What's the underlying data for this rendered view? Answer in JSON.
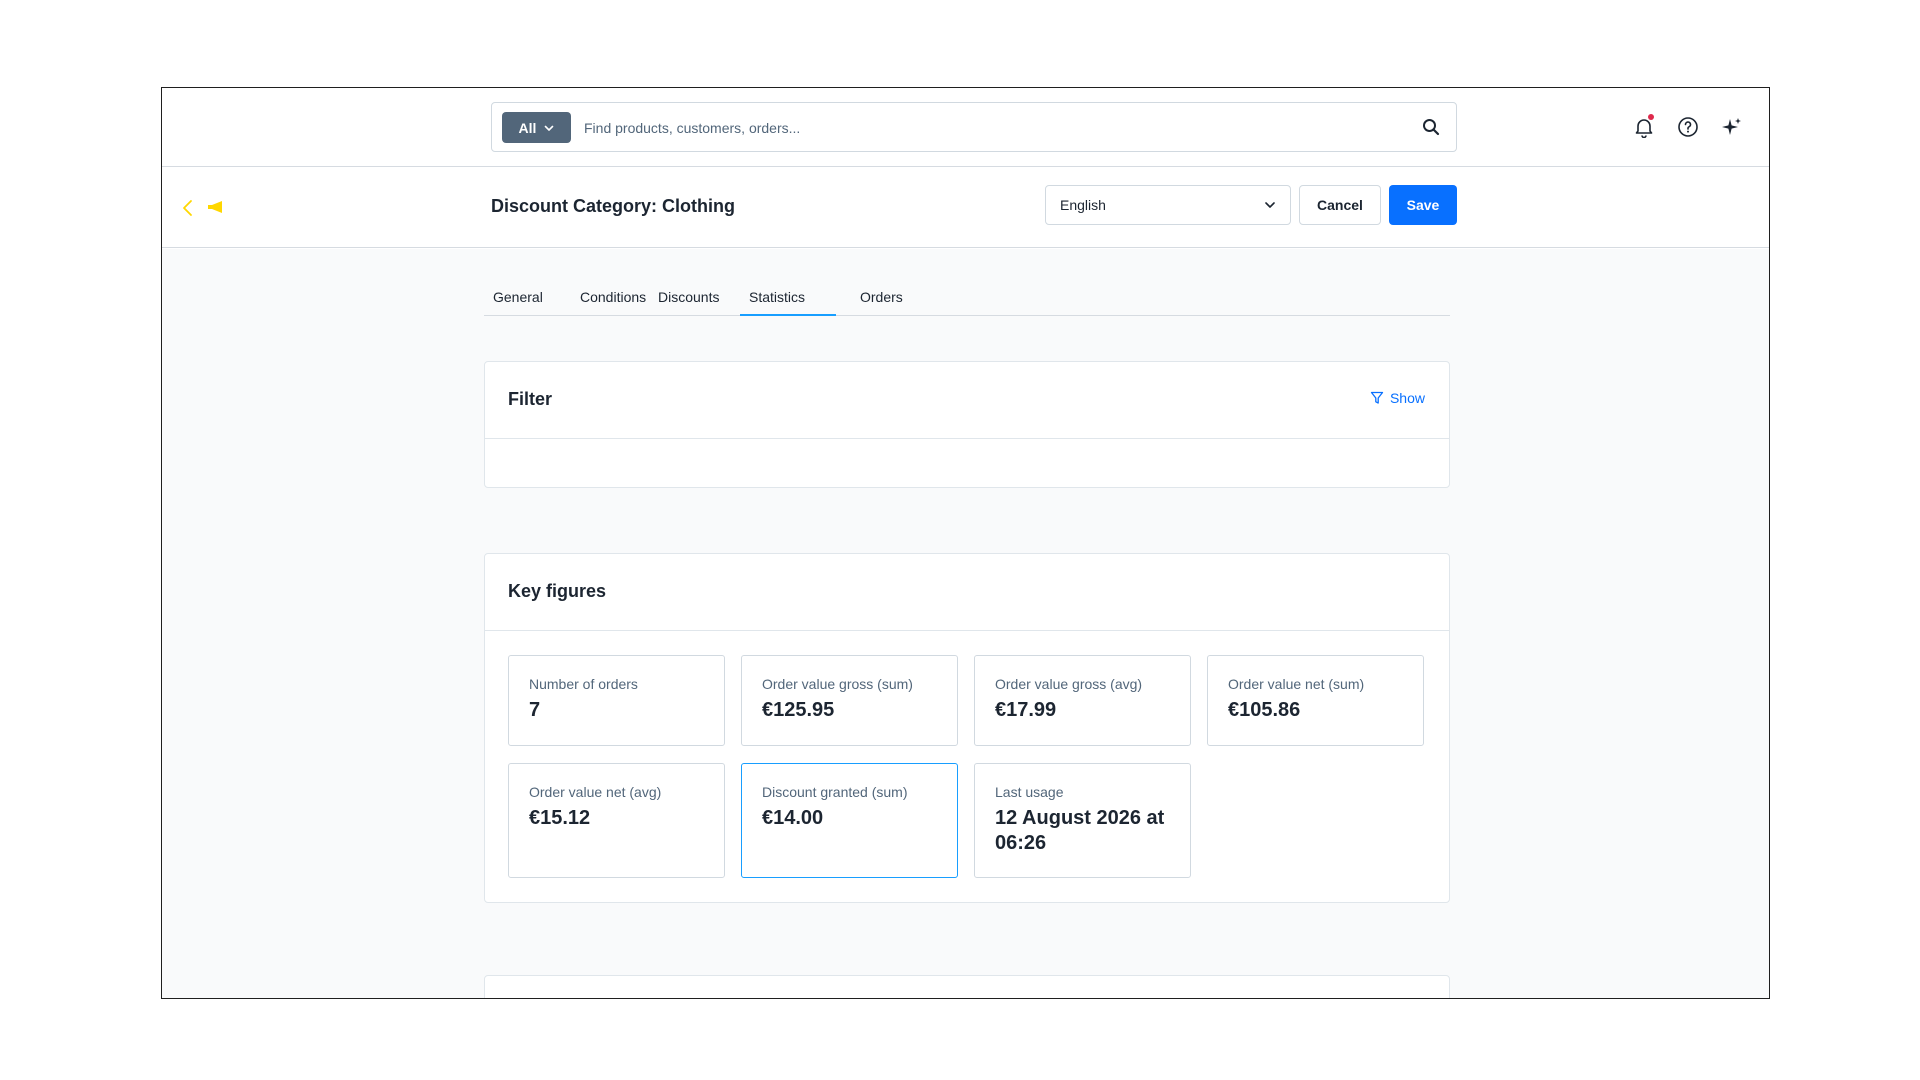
{
  "search": {
    "scope_label": "All",
    "placeholder": "Find products, customers, orders..."
  },
  "top_icons": [
    "bell-icon",
    "help-icon",
    "sparkle-icon"
  ],
  "header": {
    "title": "Discount Category: Clothing",
    "language": "English",
    "cancel_label": "Cancel",
    "save_label": "Save"
  },
  "tabs": [
    {
      "label": "General"
    },
    {
      "label": "Conditions"
    },
    {
      "label": "Discounts"
    },
    {
      "label": "Statistics",
      "active": true
    },
    {
      "label": "Orders"
    }
  ],
  "filter": {
    "title": "Filter",
    "show_label": "Show"
  },
  "key_figures": {
    "title": "Key figures",
    "items": [
      {
        "label": "Number of orders",
        "value": "7"
      },
      {
        "label": "Order value gross (sum)",
        "value": "€125.95"
      },
      {
        "label": "Order value gross (avg)",
        "value": "€17.99"
      },
      {
        "label": "Order value net (sum)",
        "value": "€105.86"
      },
      {
        "label": "Order value net (avg)",
        "value": "€15.12"
      },
      {
        "label": "Discount granted (sum)",
        "value": "€14.00"
      },
      {
        "label": "Last usage",
        "value": "12 August 2026 at 06:26"
      }
    ]
  },
  "colors": {
    "primary": "#0870ff",
    "tab_active": "#189eff",
    "accent_yellow": "#ffd700",
    "notification_dot": "#de294c"
  }
}
